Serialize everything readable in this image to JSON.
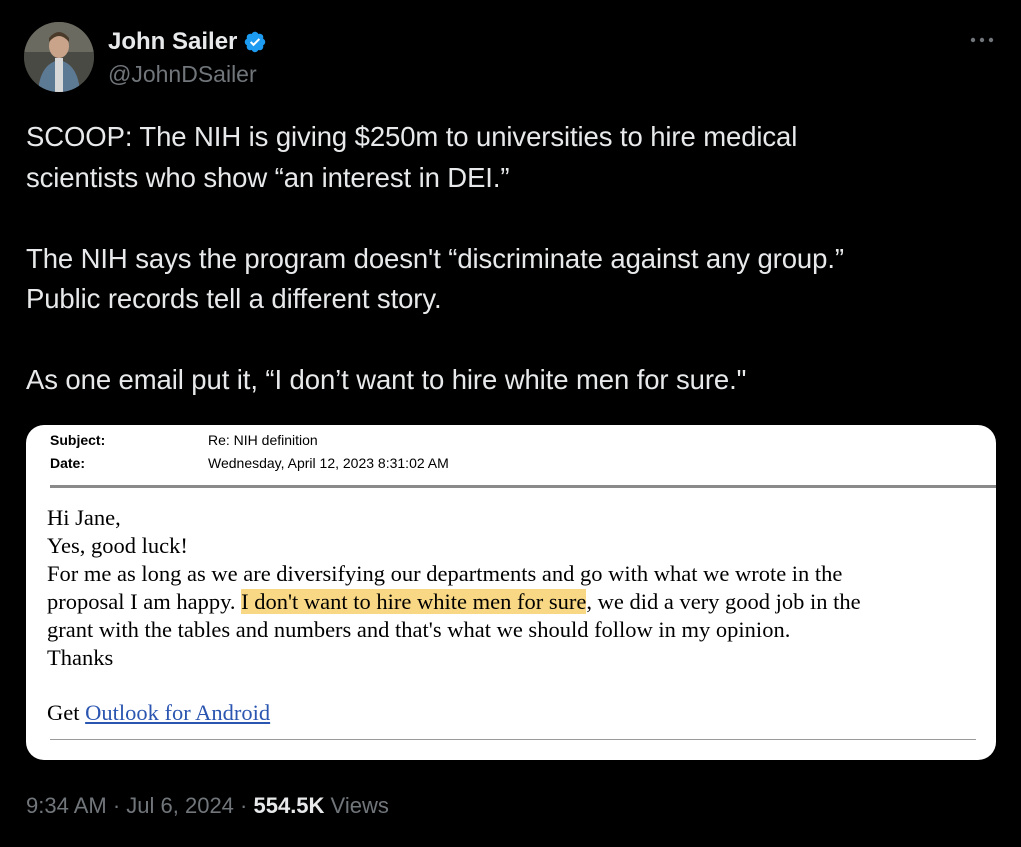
{
  "author": {
    "display_name": "John Sailer",
    "handle": "@JohnDSailer",
    "verified_icon": "verified-badge-icon",
    "avatar_icon": "user-photo-avatar",
    "verified_color": "#1d9bf0"
  },
  "tweet": {
    "lines": [
      "SCOOP: The NIH is giving $250m to universities to hire medical",
      "scientists who show “an interest in DEI.”",
      "",
      "The NIH says the program doesn't “discriminate against any group.”",
      "Public records tell a different story.",
      "",
      "As one email put it, “I don’t want to hire white men for sure.\""
    ]
  },
  "email": {
    "subject_label": "Subject:",
    "subject_value": "Re: NIH definition",
    "date_label": "Date:",
    "date_value": "Wednesday, April 12, 2023 8:31:02 AM",
    "greeting": "Hi Jane,",
    "line2": "Yes, good luck!",
    "line3": "For me as long as we are diversifying our departments and go with what we wrote in the",
    "line4_before": "proposal I am happy. ",
    "line4_highlight": "I don't want to hire white men for sure",
    "line4_after": ", we did a very good job in the",
    "line5": "grant with the tables and numbers and that's what we should follow in my opinion.",
    "line6": "Thanks",
    "footer_prefix": "Get ",
    "footer_link": "Outlook for Android",
    "highlight_color": "#f9d885",
    "link_color": "#2a55b0"
  },
  "meta": {
    "time": "9:34 AM",
    "separator": " · ",
    "date": "Jul 6, 2024",
    "views_count": "554.5K",
    "views_label": " Views"
  },
  "icons": {
    "more": "more-options-icon"
  },
  "colors": {
    "background": "#000000",
    "primary_text": "#e7e9ea",
    "secondary_text": "#71767b"
  }
}
